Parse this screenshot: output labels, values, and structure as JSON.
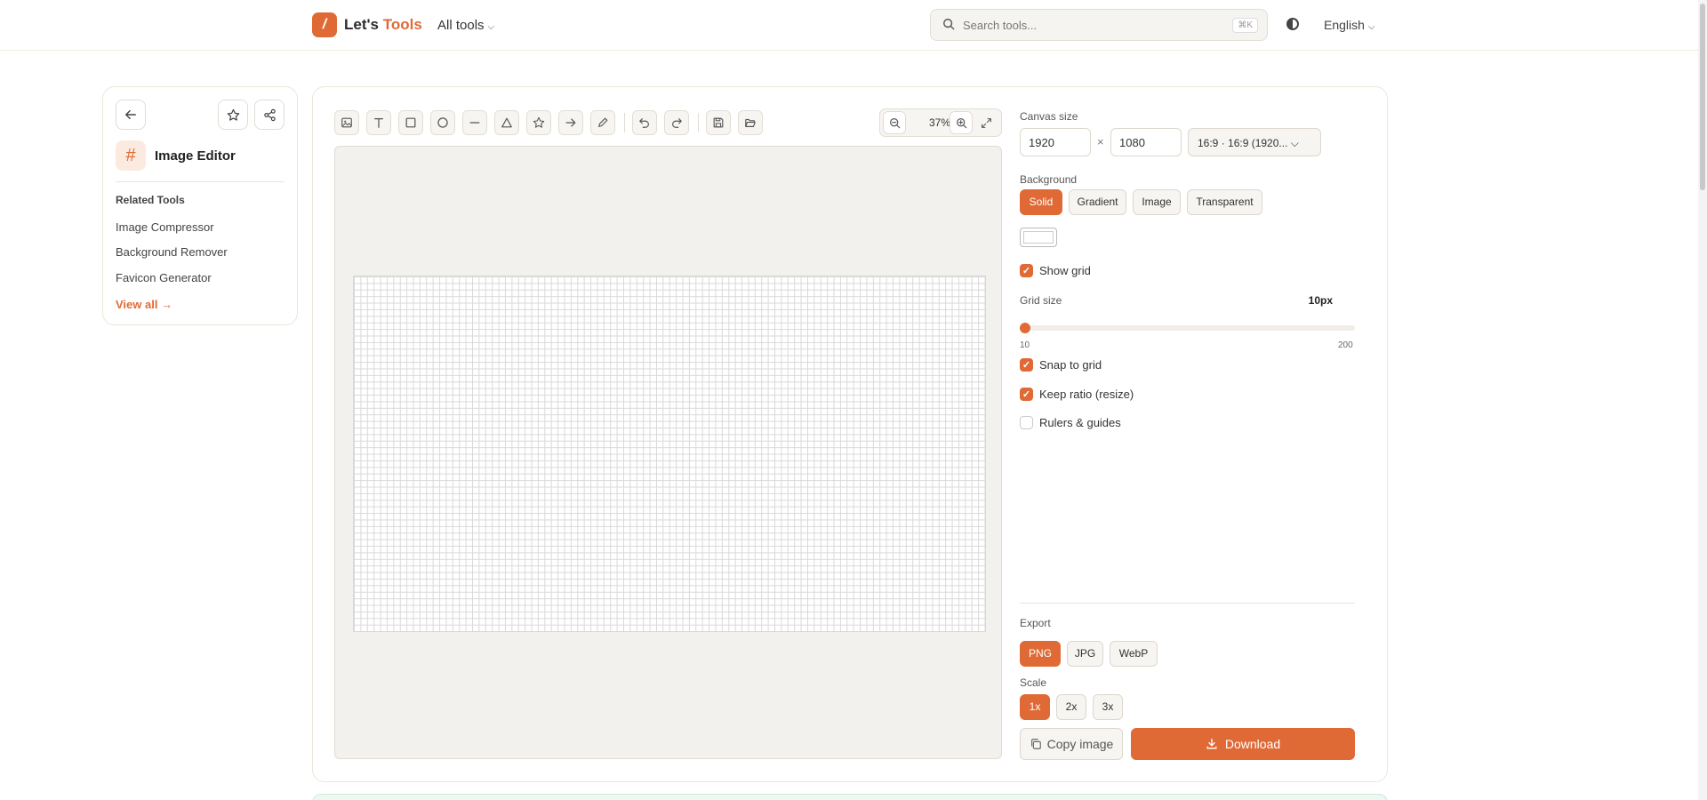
{
  "header": {
    "logo_glyph": "/",
    "brand_prefix": "Let's ",
    "brand_accent": "Tools",
    "all_tools_label": "All tools",
    "search_placeholder": "Search tools...",
    "search_shortcut": "⌘K",
    "language": "English"
  },
  "sidebar": {
    "title": "Image Editor",
    "related_heading": "Related Tools",
    "related": [
      "Image Compressor",
      "Background Remover",
      "Favicon Generator"
    ],
    "view_all": "View all →"
  },
  "editor": {
    "zoom": "37%",
    "canvas_width": "1920",
    "canvas_height": "1080",
    "times_symbol": "×",
    "aspect_select": "16:9 · 16:9 (1920...",
    "labels": {
      "canvas_size": "Canvas size",
      "background": "Background",
      "grid_size": "Grid size",
      "export": "Export",
      "scale": "Scale"
    },
    "background_options": [
      "Solid",
      "Gradient",
      "Image",
      "Transparent"
    ],
    "background_selected": "Solid",
    "background_color": "#ffffff",
    "checkboxes": {
      "show_grid": {
        "label": "Show grid",
        "checked": true
      },
      "snap_to_grid": {
        "label": "Snap to grid",
        "checked": true
      },
      "keep_ratio": {
        "label": "Keep ratio (resize)",
        "checked": true
      },
      "rulers": {
        "label": "Rulers & guides",
        "checked": false
      }
    },
    "grid_size_value": "10px",
    "grid_slider": {
      "min": "10",
      "max": "200",
      "value": 10
    },
    "export_formats": [
      "PNG",
      "JPG",
      "WebP"
    ],
    "export_selected": "PNG",
    "scales": [
      "1x",
      "2x",
      "3x"
    ],
    "scale_selected": "1x",
    "copy_label": "Copy image",
    "download_label": "Download"
  },
  "colors": {
    "accent": "#e06a36",
    "accent_soft": "#fbeadf",
    "border": "#e2ddd4"
  }
}
